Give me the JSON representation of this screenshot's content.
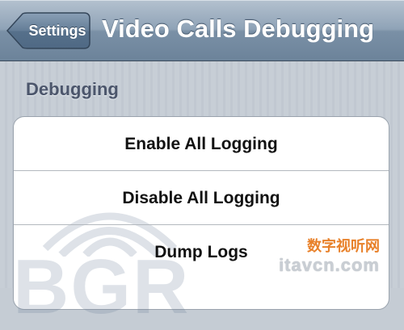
{
  "nav": {
    "back_label": "Settings",
    "title": "Video Calls Debugging"
  },
  "section": {
    "header": "Debugging"
  },
  "cells": [
    {
      "label": "Enable All Logging"
    },
    {
      "label": "Disable All Logging"
    },
    {
      "label": "Dump Logs"
    }
  ],
  "watermark": {
    "letters": "BGR"
  },
  "site_mark": {
    "cn": "数字视听网",
    "en": "itavcn.com"
  },
  "colors": {
    "nav_bar": "#8fa3b7",
    "background": "#c5ccd4",
    "section_header": "#4c566c",
    "cell_text": "#111111",
    "site_cn": "#e8812a"
  }
}
